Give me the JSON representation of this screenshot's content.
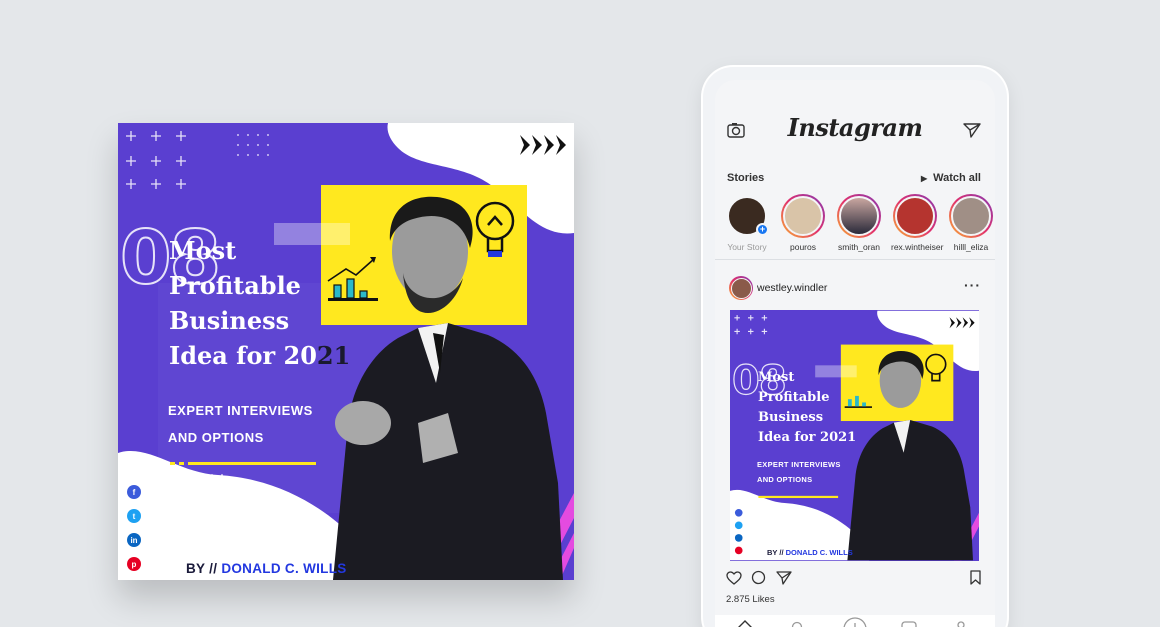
{
  "poster": {
    "number": "08",
    "headline_line1": "Most",
    "headline_line2": "Profitable",
    "headline_line3": "Business",
    "headline_line4_start": "Idea for 20",
    "headline_line4_end": "21",
    "sub_line1": "EXPERT INTERVIEWS",
    "sub_line2": "AND OPTIONS",
    "byline_prefix": "BY // ",
    "byline_name": "DONALD C. WILLS",
    "colors": {
      "purple": "#5a3fd0",
      "yellow": "#ffe81f",
      "white": "#ffffff",
      "pink": "#e44be0",
      "blue": "#2338e0"
    }
  },
  "phone": {
    "app_name": "Instagram",
    "stories_label": "Stories",
    "watch_all": "Watch all",
    "stories": [
      {
        "name": "Your Story"
      },
      {
        "name": "pouros"
      },
      {
        "name": "smith_oran"
      },
      {
        "name": "rex.wintheiser"
      },
      {
        "name": "hilll_eliza"
      }
    ],
    "post": {
      "username": "westley.windler",
      "likes": "2.875 Likes"
    },
    "post_image": {
      "number": "08",
      "headline_line1": "Most",
      "headline_line2": "Profitable",
      "headline_line3": "Business",
      "headline_line4": "Idea for 2021",
      "sub_line1": "EXPERT INTERVIEWS",
      "sub_line2": "AND OPTIONS",
      "byline_prefix": "BY // ",
      "byline_name": "DONALD C. WILLS"
    },
    "icons": [
      "camera-icon",
      "send-icon",
      "heart-icon",
      "comment-icon",
      "share-icon",
      "bookmark-icon",
      "home-icon",
      "search-icon",
      "add-icon",
      "reels-icon",
      "profile-icon"
    ]
  }
}
